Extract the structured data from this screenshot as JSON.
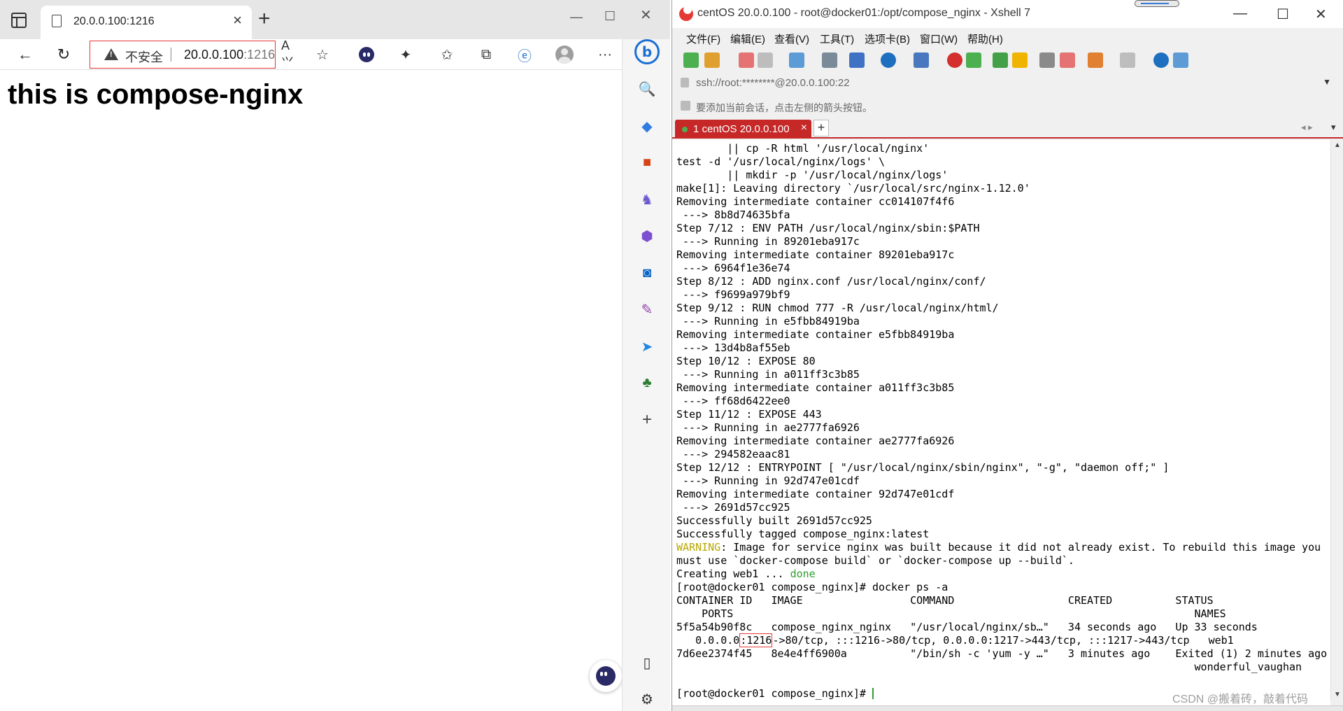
{
  "browser": {
    "tab_title": "20.0.0.100:1216",
    "address": {
      "security_label": "不安全",
      "host": "20.0.0.100",
      "port": ":1216"
    },
    "page": {
      "heading": "this is compose-nginx"
    },
    "icons": {
      "back": "back-arrow-icon",
      "refresh": "refresh-icon",
      "read_aloud": "read-aloud-icon",
      "favorite_add": "add-favorite-icon",
      "extensions": "puzzle-icon",
      "favorites": "favorites-icon",
      "collections": "collections-icon",
      "edge_bar": "edge-bar-icon",
      "more": "more-dots-icon",
      "bing": "bing-icon"
    },
    "sidebar": [
      {
        "name": "search-icon",
        "color": "#1b6fd3"
      },
      {
        "name": "shopping-tag-icon",
        "color": "#2f7de1"
      },
      {
        "name": "tools-icon",
        "color": "#d84315"
      },
      {
        "name": "games-icon",
        "color": "#6a5acd"
      },
      {
        "name": "office-icon",
        "color": "#7b4fd0"
      },
      {
        "name": "outlook-icon",
        "color": "#0a64c8"
      },
      {
        "name": "edit-icon",
        "color": "#8e44ad"
      },
      {
        "name": "send-icon",
        "color": "#1e88e5"
      },
      {
        "name": "tree-icon",
        "color": "#2e7d32"
      },
      {
        "name": "add-icon",
        "color": "#444444"
      }
    ]
  },
  "xshell": {
    "title": "centOS 20.0.0.100 - root@docker01:/opt/compose_nginx - Xshell 7",
    "menu": [
      "文件(F)",
      "编辑(E)",
      "查看(V)",
      "工具(T)",
      "选项卡(B)",
      "窗口(W)",
      "帮助(H)"
    ],
    "address": "ssh://root:********@20.0.0.100:22",
    "hint": "要添加当前会话，点击左侧的箭头按钮。",
    "session_tab": "1 centOS 20.0.0.100",
    "accent_color": "#c62828",
    "terminal": [
      {
        "t": "        || cp -R html '/usr/local/nginx'"
      },
      {
        "t": "test -d '/usr/local/nginx/logs' \\"
      },
      {
        "t": "        || mkdir -p '/usr/local/nginx/logs'"
      },
      {
        "t": "make[1]: Leaving directory `/usr/local/src/nginx-1.12.0'"
      },
      {
        "t": "Removing intermediate container cc014107f4f6"
      },
      {
        "t": " ---> 8b8d74635bfa"
      },
      {
        "t": "Step 7/12 : ENV PATH /usr/local/nginx/sbin:$PATH"
      },
      {
        "t": " ---> Running in 89201eba917c"
      },
      {
        "t": "Removing intermediate container 89201eba917c"
      },
      {
        "t": " ---> 6964f1e36e74"
      },
      {
        "t": "Step 8/12 : ADD nginx.conf /usr/local/nginx/conf/"
      },
      {
        "t": " ---> f9699a979bf9"
      },
      {
        "t": "Step 9/12 : RUN chmod 777 -R /usr/local/nginx/html/"
      },
      {
        "t": " ---> Running in e5fbb84919ba"
      },
      {
        "t": "Removing intermediate container e5fbb84919ba"
      },
      {
        "t": " ---> 13d4b8af55eb"
      },
      {
        "t": "Step 10/12 : EXPOSE 80"
      },
      {
        "t": " ---> Running in a011ff3c3b85"
      },
      {
        "t": "Removing intermediate container a011ff3c3b85"
      },
      {
        "t": " ---> ff68d6422ee0"
      },
      {
        "t": "Step 11/12 : EXPOSE 443"
      },
      {
        "t": " ---> Running in ae2777fa6926"
      },
      {
        "t": "Removing intermediate container ae2777fa6926"
      },
      {
        "t": " ---> 294582eaac81"
      },
      {
        "t": "Step 12/12 : ENTRYPOINT [ \"/usr/local/nginx/sbin/nginx\", \"-g\", \"daemon off;\" ]"
      },
      {
        "t": " ---> Running in 92d747e01cdf"
      },
      {
        "t": "Removing intermediate container 92d747e01cdf"
      },
      {
        "t": " ---> 2691d57cc925"
      },
      {
        "t": "Successfully built 2691d57cc925"
      },
      {
        "t": "Successfully tagged compose_nginx:latest"
      },
      {
        "warn": "WARNING",
        "t": ": Image for service nginx was built because it did not already exist. To rebuild this image you"
      },
      {
        "t": "must use `docker-compose build` or `docker-compose up --build`."
      },
      {
        "t": "Creating web1 ... ",
        "done": "done"
      },
      {
        "t": "[root@docker01 compose_nginx]# docker ps -a"
      },
      {
        "t": "CONTAINER ID   IMAGE                 COMMAND                  CREATED          STATUS"
      },
      {
        "t": "    PORTS                                                                         NAMES"
      },
      {
        "t": "5f5a54b90f8c   compose_nginx_nginx   \"/usr/local/nginx/sb…\"   34 seconds ago   Up 33 seconds"
      },
      {
        "pre": "   0.0.0.0",
        "hl": ":1216",
        "t": "->80/tcp, :::1216->80/tcp, 0.0.0.0:1217->443/tcp, :::1217->443/tcp   web1"
      },
      {
        "t": "7d6ee2374f45   8e4e4ff6900a          \"/bin/sh -c 'yum -y …\"   3 minutes ago    Exited (1) 2 minutes ago"
      },
      {
        "t": "                                                                                  wonderful_vaughan"
      },
      {
        "t": ""
      },
      {
        "t": "[root@docker01 compose_nginx]# ",
        "cursor": true
      }
    ]
  },
  "watermark": "CSDN @搬着砖，敲着代码"
}
